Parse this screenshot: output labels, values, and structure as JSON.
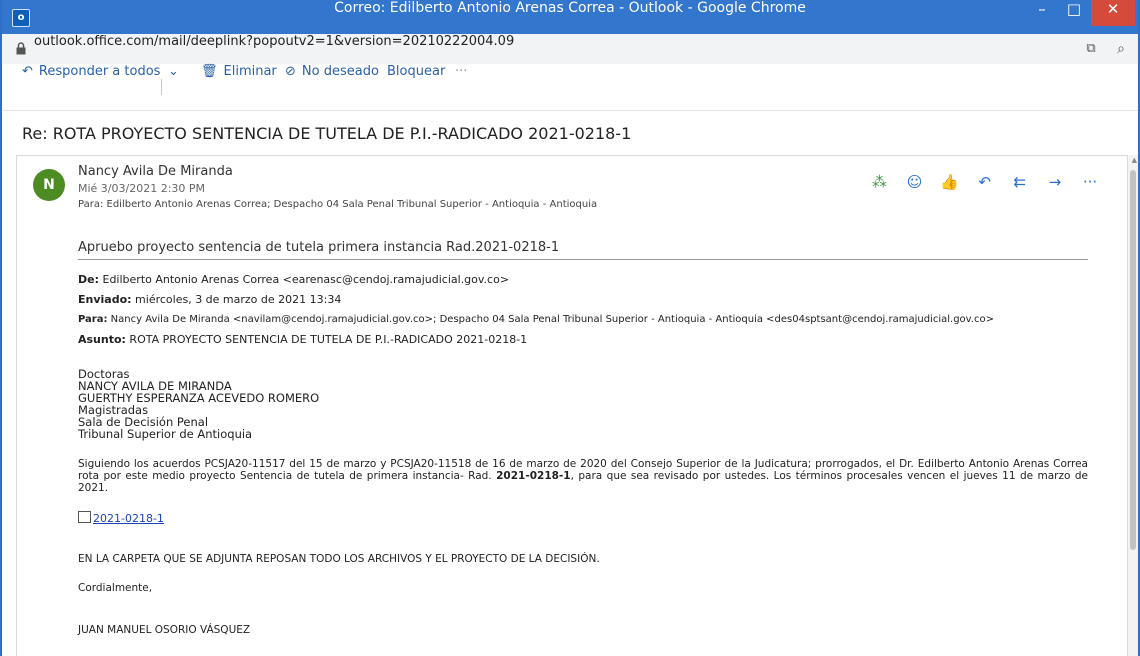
{
  "window": {
    "app_icon": "o",
    "title": "Correo: Edilberto Antonio Arenas Correa - Outlook - Google Chrome",
    "minimize": "–",
    "maximize": "□",
    "close": "✕"
  },
  "address_bar": {
    "url": "outlook.office.com/mail/deeplink?popoutv2=1&version=20210222004.09",
    "icons": [
      "lock-icon",
      "open-in-window-icon",
      "zoom-icon"
    ]
  },
  "toolbar": {
    "reply_all": "Responder a todos",
    "delete": "Eliminar",
    "junk": "No deseado",
    "block": "Bloquear",
    "more": "···",
    "icons": [
      "reply-all-icon",
      "chevron-down-icon",
      "trash-icon",
      "block-icon"
    ]
  },
  "message": {
    "subject": "Re: ROTA PROYECTO SENTENCIA DE TUTELA DE P.I.-RADICADO 2021-0218-1",
    "avatar_initial": "N",
    "avatar_color": "#4c8c23",
    "sender": "Nancy Avila De Miranda",
    "date": "Mié 3/03/2021 2:30 PM",
    "to": "Para:  Edilberto Antonio Arenas Correa; Despacho 04 Sala Penal Tribunal Superior - Antioquia - Antioquia",
    "actions": [
      "apps-icon",
      "emoji-icon",
      "like-icon",
      "reply-icon",
      "reply-all-icon",
      "forward-icon",
      "more-icon"
    ],
    "more": "···",
    "lead": "Apruebo proyecto sentencia de tutela primera instancia Rad.2021-0218-1",
    "quoted": {
      "from_label": "De:",
      "from": " Edilberto Antonio Arenas Correa <earenasc@cendoj.ramajudicial.gov.co>",
      "sent_label": "Enviado:",
      "sent": " miércoles, 3 de marzo de 2021 13:34",
      "to_label": "Para:",
      "to": " Nancy Avila De Miranda <navilam@cendoj.ramajudicial.gov.co>; Despacho 04 Sala Penal Tribunal Superior - Antioquia - Antioquia <des04sptsant@cendoj.ramajudicial.gov.co>",
      "subject_label": "Asunto:",
      "subject": " ROTA PROYECTO SENTENCIA DE TUTELA DE P.I.-RADICADO 2021-0218-1"
    },
    "salutation_lines": [
      "Doctoras",
      "NANCY AVILA DE MIRANDA",
      "GUERTHY ESPERANZA ACEVEDO ROMERO",
      "Magistradas",
      "Sala de Decisión Penal",
      "Tribunal Superior de Antioquia"
    ],
    "paragraph_a": "Siguiendo los acuerdos PCSJA20-11517 del 15 de marzo y PCSJA20-11518 de 16 de marzo de 2020 del Consejo Superior de la Judicatura; prorrogados, el Dr. Edilberto Antonio Arenas Correa rota por este medio proyecto Sentencia de tutela de primera instancia- Rad. ",
    "paragraph_bold": "2021-0218-1",
    "paragraph_b": ", para que sea revisado por ustedes. Los términos procesales vencen el jueves 11 de marzo de 2021.",
    "attachment": "2021-0218-1",
    "note": "EN LA CARPETA QUE SE ADJUNTA REPOSAN TODO LOS ARCHIVOS Y EL PROYECTO DE LA DECISIÓN.",
    "closing": "Cordialmente,",
    "signature": "JUAN MANUEL OSORIO VÁSQUEZ"
  }
}
